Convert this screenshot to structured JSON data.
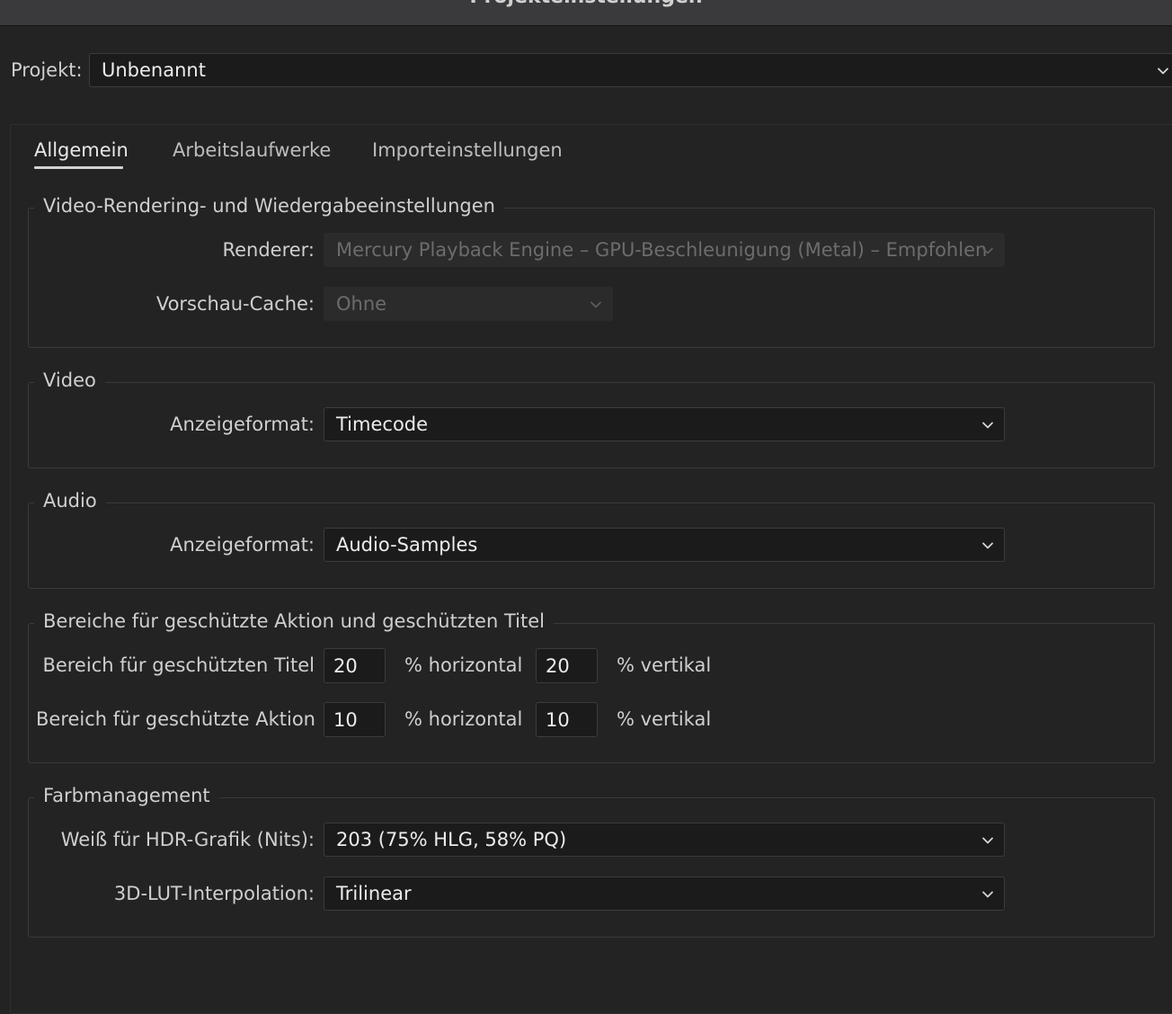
{
  "window": {
    "title": "Projekteinstellungen"
  },
  "project": {
    "label": "Projekt:",
    "value": "Unbenannt"
  },
  "tabs": [
    {
      "label": "Allgemein",
      "active": true
    },
    {
      "label": "Arbeitslaufwerke",
      "active": false
    },
    {
      "label": "Importeinstellungen",
      "active": false
    }
  ],
  "rendering": {
    "legend": "Video-Rendering- und Wiedergabeeinstellungen",
    "renderer_label": "Renderer:",
    "renderer_value": "Mercury Playback Engine – GPU-Beschleunigung (Metal) – Empfohlen",
    "cache_label": "Vorschau-Cache:",
    "cache_value": "Ohne"
  },
  "video": {
    "legend": "Video",
    "format_label": "Anzeigeformat:",
    "format_value": "Timecode"
  },
  "audio": {
    "legend": "Audio",
    "format_label": "Anzeigeformat:",
    "format_value": "Audio-Samples"
  },
  "safe": {
    "legend": "Bereiche für geschützte Aktion und geschützten Titel",
    "title_label": "Bereich für geschützten Titel",
    "title_h": "20",
    "title_v": "20",
    "action_label": "Bereich für geschützte Aktion",
    "action_h": "10",
    "action_v": "10",
    "horizontal_unit": "% horizontal",
    "vertical_unit": "% vertikal"
  },
  "color": {
    "legend": "Farbmanagement",
    "hdr_label": "Weiß für HDR-Grafik (Nits):",
    "hdr_value": "203 (75% HLG, 58% PQ)",
    "lut_label": "3D-LUT-Interpolation:",
    "lut_value": "Trilinear"
  },
  "icons": {
    "dropdown": "chevron-down-icon"
  },
  "colors": {
    "background": "#232323",
    "field": "#1b1b1b",
    "text": "#d6d6d6"
  }
}
